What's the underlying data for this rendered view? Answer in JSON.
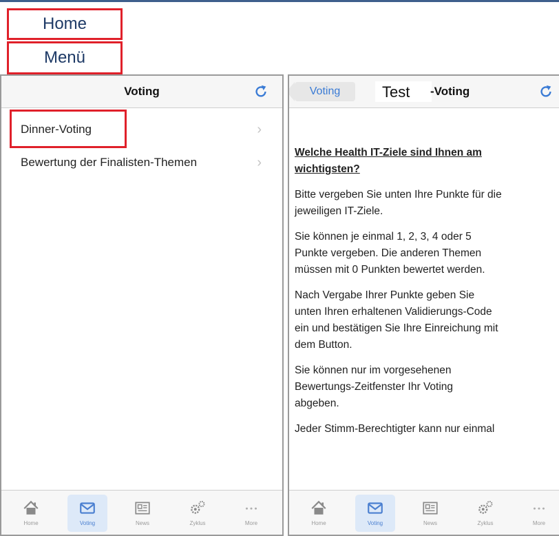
{
  "callouts": {
    "home": "Home",
    "menu": "Menü",
    "test": "Test"
  },
  "colors": {
    "accent": "#3a7bd5",
    "callout_border": "#e0202a",
    "active_tab_bg": "#dde9f8"
  },
  "left_panel": {
    "title": "Voting",
    "refresh_icon": "refresh-icon",
    "items": [
      {
        "label": "Dinner-Voting"
      },
      {
        "label": "Bewertung der Finalisten-Themen"
      }
    ]
  },
  "right_panel": {
    "back_label": "Voting",
    "title": "-Voting",
    "question": [
      "Welche Health IT-Ziele sind Ihnen am",
      "wichtigsten?"
    ],
    "paragraphs": [
      [
        "Bitte vergeben Sie unten Ihre Punkte für die",
        "jeweiligen IT-Ziele."
      ],
      [
        "Sie können je einmal 1, 2, 3, 4 oder 5",
        "Punkte vergeben. Die anderen Themen",
        "müssen mit 0 Punkten bewertet werden."
      ],
      [
        "Nach Vergabe Ihrer Punkte geben Sie",
        "unten Ihren erhaltenen Validierungs-Code",
        "ein und bestätigen Sie Ihre Einreichung mit",
        "dem Button."
      ],
      [
        "Sie können nur im vorgesehenen",
        "Bewertungs-Zeitfenster Ihr Voting",
        "abgeben."
      ],
      [
        "Jeder Stimm-Berechtigter kann nur einmal"
      ]
    ]
  },
  "tabs": [
    {
      "label": "Home",
      "icon": "home-icon",
      "active": false
    },
    {
      "label": "Voting",
      "icon": "envelope-icon",
      "active": true
    },
    {
      "label": "News",
      "icon": "newspaper-icon",
      "active": false
    },
    {
      "label": "Zyklus",
      "icon": "gears-icon",
      "active": false
    },
    {
      "label": "More",
      "icon": "more-dots-icon",
      "active": false
    }
  ]
}
